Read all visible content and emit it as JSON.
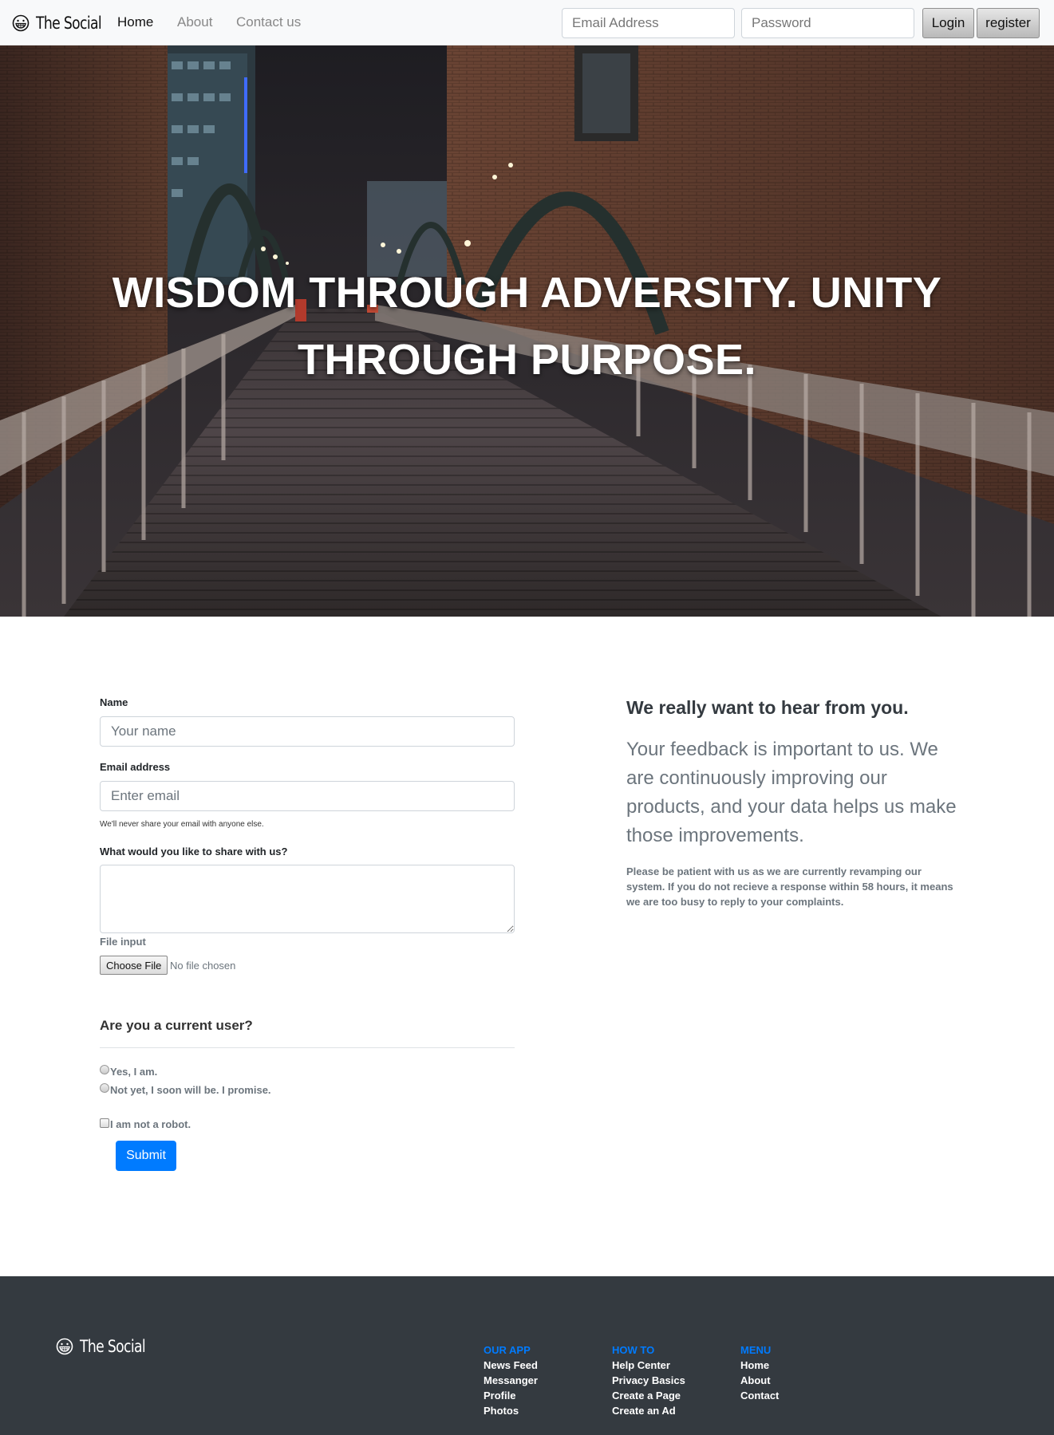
{
  "navbar": {
    "brand": "The Social",
    "links": [
      "Home",
      "About",
      "Contact us"
    ],
    "email_placeholder": "Email Address",
    "password_placeholder": "Password",
    "login_label": "Login",
    "register_label": "register"
  },
  "hero": {
    "title": "WISDOM THROUGH ADVERSITY. UNITY THROUGH PURPOSE."
  },
  "form": {
    "name_label": "Name",
    "name_placeholder": "Your name",
    "email_label": "Email address",
    "email_placeholder": "Enter email",
    "email_help": "We'll never share your email with anyone else.",
    "message_label": "What would you like to share with us?",
    "file_label": "File input",
    "file_button": "Choose File",
    "file_status": "No file chosen",
    "question": "Are you a current user?",
    "radio_yes": "Yes, I am.",
    "radio_no": "Not yet, I soon will be. I promise.",
    "robot": "I am not a robot.",
    "submit": "Submit"
  },
  "contact_info": {
    "heading": "We really want to hear from you.",
    "lead": "Your feedback is important to us. We are continuously improving our products, and your data helps us make those improvements.",
    "note": "Please be patient with us as we are currently revamping our system. If you do not recieve a response within 58 hours, it means we are too busy to reply to your complaints."
  },
  "footer": {
    "brand": "The Social",
    "columns": [
      {
        "title": "OUR APP",
        "links": [
          "News Feed",
          "Messanger",
          "Profile",
          "Photos"
        ]
      },
      {
        "title": "HOW TO",
        "links": [
          "Help Center",
          "Privacy Basics",
          "Create a Page",
          "Create an Ad"
        ]
      },
      {
        "title": "MENU",
        "links": [
          "Home",
          "About",
          "Contact"
        ]
      }
    ]
  },
  "colors": {
    "primary": "#007bff",
    "footer_bg": "#343a40",
    "navbar_bg": "#f8f9fa"
  }
}
